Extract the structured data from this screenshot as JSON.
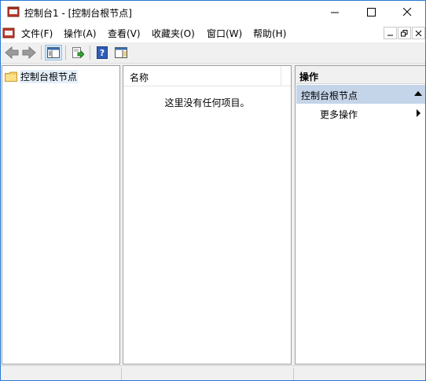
{
  "window": {
    "title": "控制台1 - [控制台根节点]",
    "controls": {
      "minimize": "minimize",
      "maximize": "maximize",
      "close": "close"
    }
  },
  "menubar": {
    "items": [
      {
        "label": "文件(F)"
      },
      {
        "label": "操作(A)"
      },
      {
        "label": "查看(V)"
      },
      {
        "label": "收藏夹(O)"
      },
      {
        "label": "窗口(W)"
      },
      {
        "label": "帮助(H)"
      }
    ]
  },
  "toolbar": {
    "buttons": [
      {
        "icon": "back-arrow-icon"
      },
      {
        "icon": "forward-arrow-icon"
      },
      {
        "icon": "show-hide-tree-icon"
      },
      {
        "icon": "export-list-icon"
      },
      {
        "icon": "help-icon"
      },
      {
        "icon": "show-hide-action-pane-icon"
      }
    ]
  },
  "tree": {
    "root": {
      "label": "控制台根节点",
      "icon": "folder-icon"
    }
  },
  "list": {
    "columns": [
      {
        "label": "名称"
      }
    ],
    "empty_message": "这里没有任何项目。"
  },
  "actions": {
    "header": "操作",
    "section": "控制台根节点",
    "items": [
      {
        "label": "更多操作"
      }
    ]
  },
  "colors": {
    "selection_bg": "#e5f0fb",
    "section_bg": "#c4d4e9",
    "window_border": "#2b78d8",
    "folder": "#f2cd6a"
  }
}
